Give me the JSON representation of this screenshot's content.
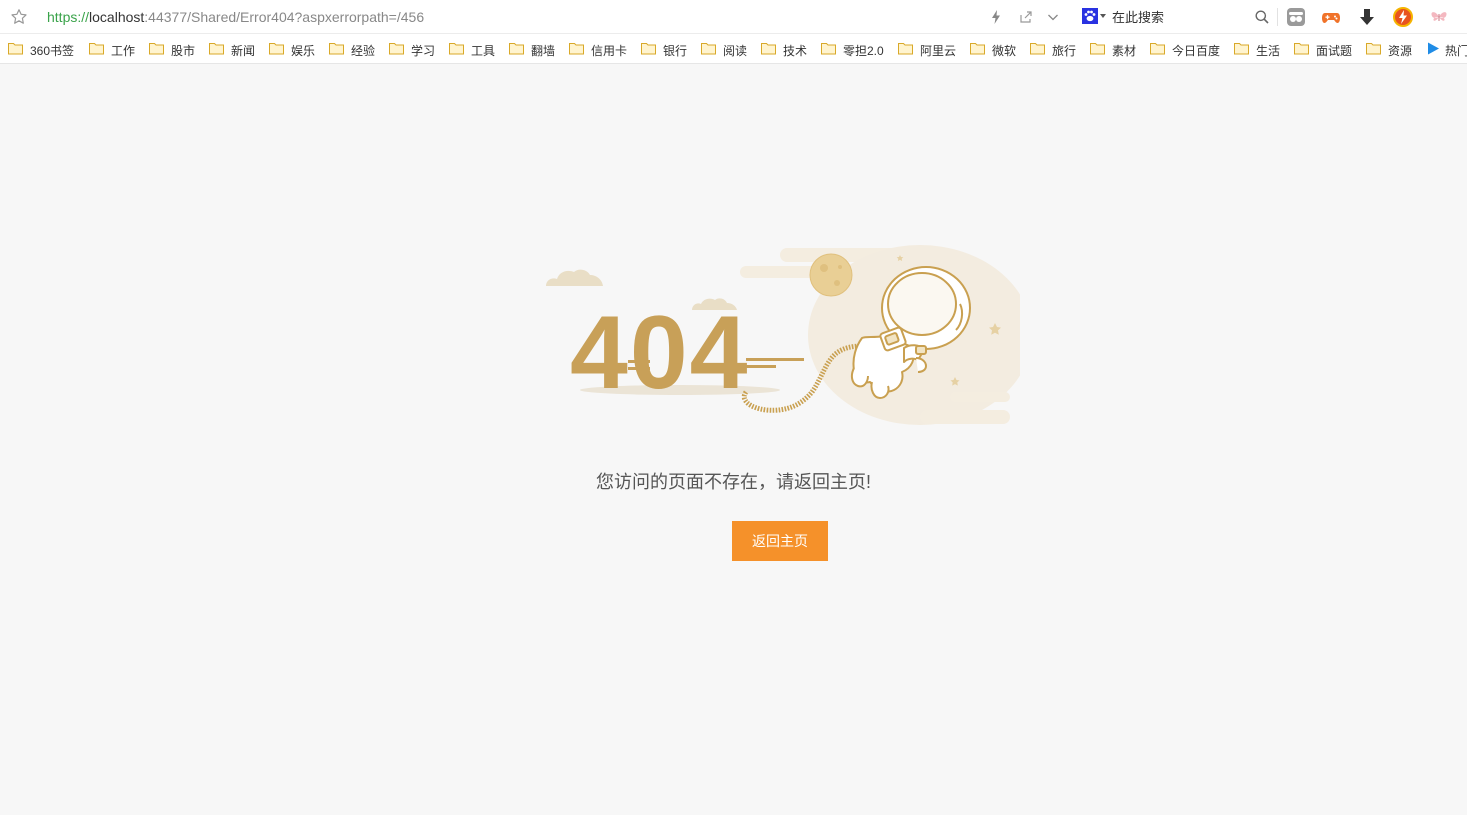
{
  "address_bar": {
    "url_scheme": "https://",
    "url_host": "localhost",
    "url_rest": ":44377/Shared/Error404?aspxerrorpath=/456",
    "search_placeholder": "在此搜索"
  },
  "bookmarks": [
    {
      "label": "360书签"
    },
    {
      "label": "工作"
    },
    {
      "label": "股市"
    },
    {
      "label": "新闻"
    },
    {
      "label": "娱乐"
    },
    {
      "label": "经验"
    },
    {
      "label": "学习"
    },
    {
      "label": "工具"
    },
    {
      "label": "翻墙"
    },
    {
      "label": "信用卡"
    },
    {
      "label": "银行"
    },
    {
      "label": "阅读"
    },
    {
      "label": "技术"
    },
    {
      "label": "零担2.0"
    },
    {
      "label": "阿里云"
    },
    {
      "label": "微软"
    },
    {
      "label": "旅行"
    },
    {
      "label": "素材"
    },
    {
      "label": "今日百度"
    },
    {
      "label": "生活"
    },
    {
      "label": "面试题"
    },
    {
      "label": "资源"
    },
    {
      "label": "热门"
    }
  ],
  "error": {
    "code": "404",
    "message": "您访问的页面不存在，请返回主页!",
    "home_button": "返回主页"
  },
  "colors": {
    "accent": "#f5912a",
    "gold": "#c9a050",
    "background": "#f7f7f7"
  }
}
